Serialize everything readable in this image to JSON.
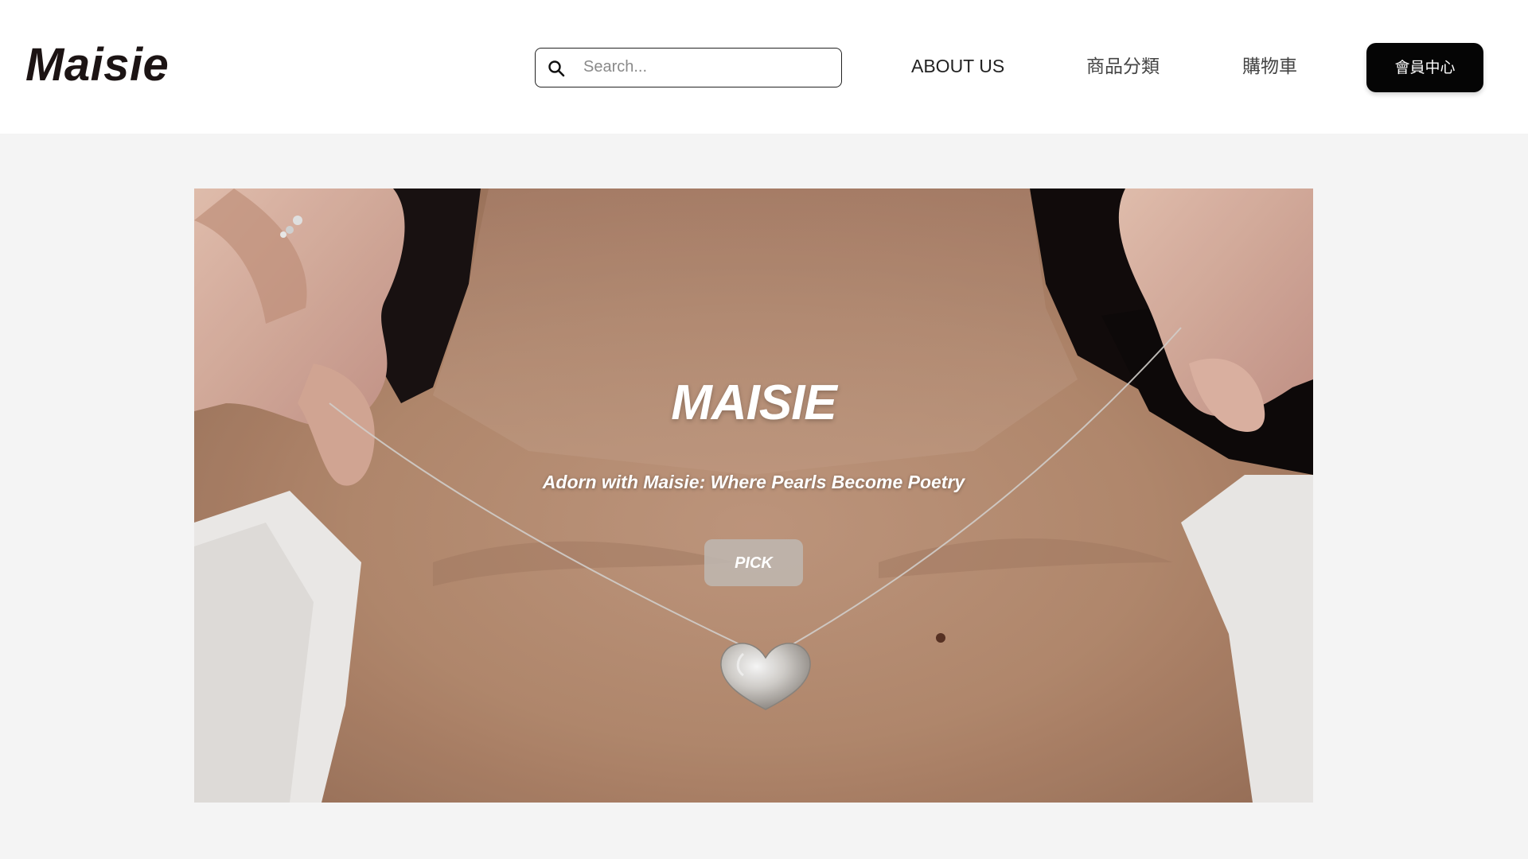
{
  "header": {
    "logo": "Maisie",
    "search": {
      "placeholder": "Search...",
      "value": "",
      "icon": "search-icon"
    },
    "nav": {
      "about": "ABOUT US",
      "categories": "商品分類",
      "cart": "購物車"
    },
    "member_button": "會員中心"
  },
  "hero": {
    "title": "MAISIE",
    "subtitle": "Adorn with Maisie: Where Pearls Become Poetry",
    "cta": "PICK"
  },
  "colors": {
    "header_bg": "#ffffff",
    "page_bg": "#f4f4f4",
    "member_button_bg": "#050505",
    "pick_button_bg": "#beb6af",
    "text_dark": "#1c1414"
  }
}
